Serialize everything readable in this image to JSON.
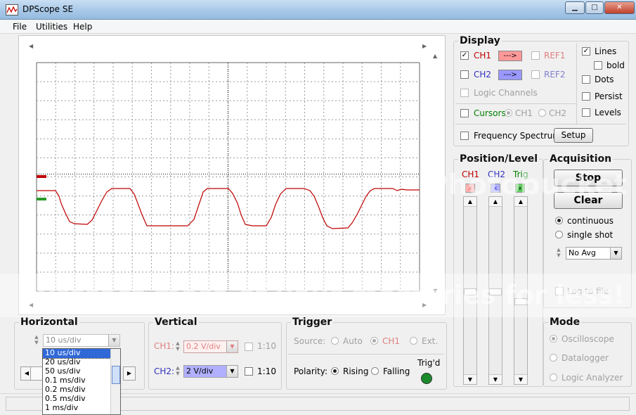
{
  "window": {
    "title": "DPScope SE",
    "min_icon": "minimize-icon",
    "max_icon": "maximize-icon",
    "close_icon": "close-icon"
  },
  "menu": [
    "File",
    "Utilities",
    "Help"
  ],
  "display": {
    "title": "Display",
    "ch1": {
      "label": "CH1",
      "checked": true,
      "arrow": "--->",
      "color": "#ff9999"
    },
    "ch2": {
      "label": "CH2",
      "checked": false,
      "arrow": "--->",
      "color": "#9999ff"
    },
    "ref1": "REF1",
    "ref2": "REF2",
    "lines": "Lines",
    "bold": "bold",
    "dots": "Dots",
    "persist": "Persist",
    "levels": "Levels",
    "logic_channels": "Logic Channels",
    "cursors": "Cursors",
    "cursor_ch1": "CH1",
    "cursor_ch2": "CH2",
    "frequency_spectrum": "Frequency Spectrum",
    "setup": "Setup"
  },
  "position": {
    "title": "Position/Level",
    "ch1": "CH1",
    "ch2": "CH2",
    "trig": "Trig",
    "trig_tag": "x"
  },
  "acquisition": {
    "title": "Acquisition",
    "stop": "Stop",
    "clear": "Clear",
    "continuous": "continuous",
    "single_shot": "single shot",
    "averaging": "No Avg",
    "log_to_file": "Log to file"
  },
  "horizontal": {
    "title": "Horizontal",
    "timebase": "10 us/div",
    "options": [
      "10 us/div",
      "20 us/div",
      "50 us/div",
      "0.1 ms/div",
      "0.2 ms/div",
      "0.5 ms/div",
      "1 ms/div"
    ]
  },
  "vertical": {
    "title": "Vertical",
    "ch1_label": "CH1:",
    "ch1_value": "0.2 V/div",
    "ch1_probe": "1:10",
    "ch2_label": "CH2:",
    "ch2_value": "2 V/div",
    "ch2_probe": "1:10"
  },
  "trigger": {
    "title": "Trigger",
    "source_label": "Source:",
    "auto": "Auto",
    "ch1": "CH1",
    "ext": "Ext.",
    "polarity_label": "Polarity:",
    "rising": "Rising",
    "falling": "Falling",
    "trigd": "Trig'd",
    "trigd_color": "#1a8a2a"
  },
  "mode": {
    "title": "Mode",
    "oscilloscope": "Oscilloscope",
    "datalogger": "Datalogger",
    "logic_analyzer": "Logic Analyzer"
  },
  "watermark": {
    "text": "Protect more of your memories for less!",
    "logo": "Photobucket"
  },
  "colors": {
    "trace": "#c00000",
    "grid": "#888888",
    "ch1_marker": "#c00000",
    "ch2_marker": "#2a9a2a"
  }
}
